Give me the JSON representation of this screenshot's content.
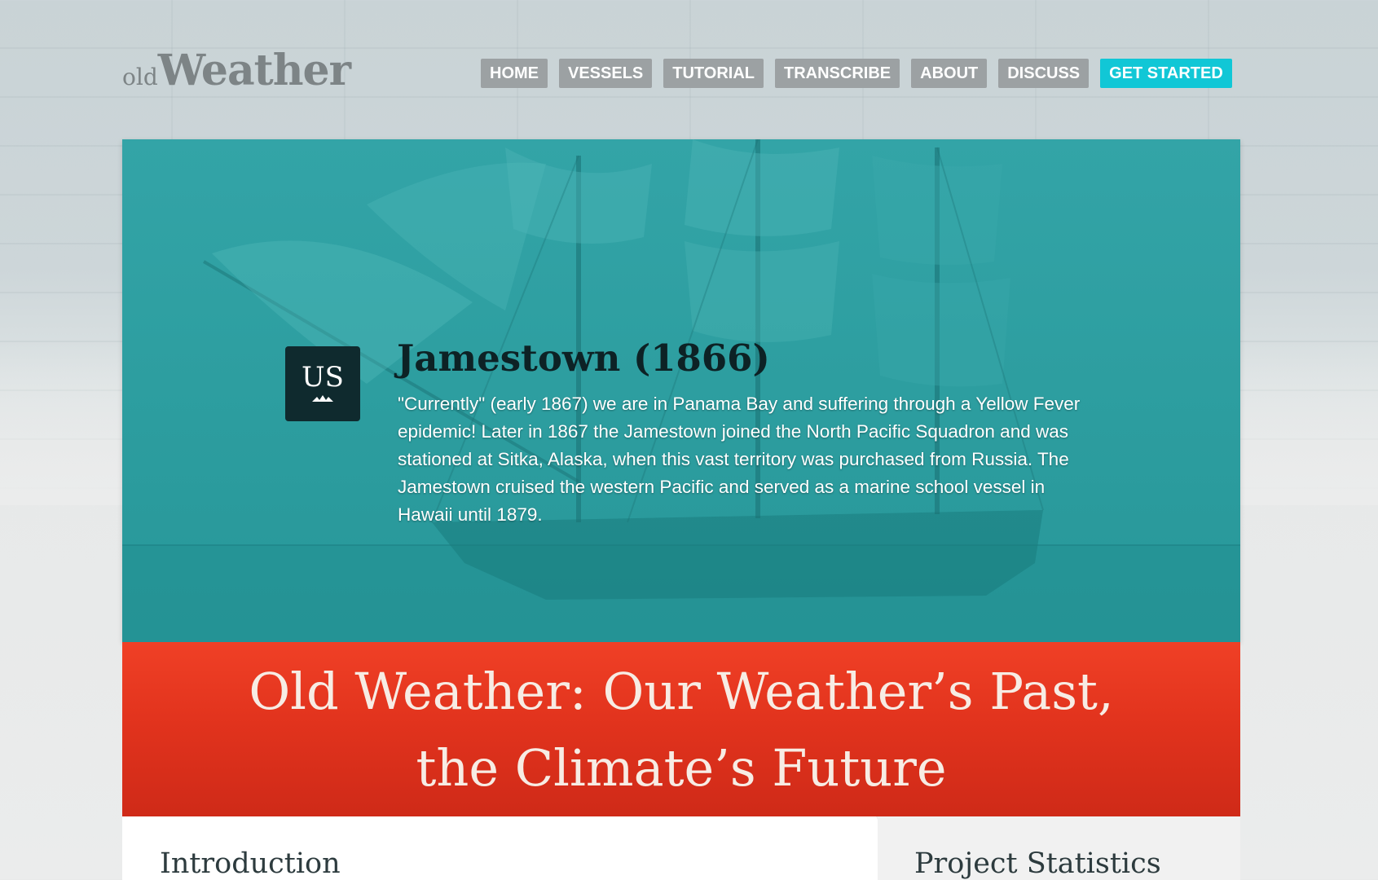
{
  "header": {
    "logo_prefix": "old",
    "logo_main": "Weather",
    "nav": [
      {
        "label": "HOME"
      },
      {
        "label": "VESSELS"
      },
      {
        "label": "TUTORIAL"
      },
      {
        "label": "TRANSCRIBE"
      },
      {
        "label": "ABOUT"
      },
      {
        "label": "DISCUSS"
      },
      {
        "label": "GET STARTED"
      }
    ]
  },
  "hero": {
    "badge_code": "US",
    "badge_icon": "wave-icon",
    "vessel_title": "Jamestown (1866)",
    "vessel_description": "\"Currently\" (early 1867) we are in Panama Bay and suffering through a Yellow Fever epidemic! Later in 1867 the Jamestown joined the North Pacific Squadron and was stationed at Sitka, Alaska, when this vast territory was purchased from Russia. The Jamestown cruised the western Pacific and served as a marine school vessel in Hawaii until 1879."
  },
  "banner": {
    "line1": "Old Weather: Our Weather’s Past,",
    "line2": "the Climate’s Future"
  },
  "sections": {
    "left_title": "Introduction",
    "right_title": "Project Statistics"
  },
  "colors": {
    "nav_bg": "#9ca1a3",
    "accent": "#11c7d6",
    "hero_teal": "#2d9ea0",
    "banner_red": "#e1331d",
    "badge_dark": "#0f2a2e"
  }
}
